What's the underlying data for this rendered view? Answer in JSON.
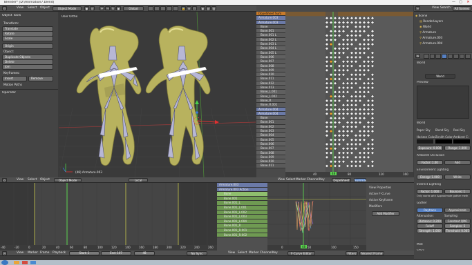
{
  "window": {
    "title": "Blender* [D:\\Animation7.blend]",
    "controls": [
      "—",
      "▢",
      "✕"
    ]
  },
  "header3d": {
    "menus": [
      "View",
      "Select",
      "Object"
    ],
    "mode": "Object Mode",
    "orientation": "Global"
  },
  "topRight": {
    "menus": [
      "View",
      "Search",
      "All Scenes"
    ]
  },
  "toolshelf": {
    "title": "Object Tools",
    "transform": {
      "title": "Transform:",
      "buttons": [
        "Translate",
        "Rotate",
        "Scale"
      ]
    },
    "origin_button": "Origin",
    "object": {
      "title": "Object:",
      "buttons": [
        "Duplicate Objects",
        "Delete",
        "Join"
      ]
    },
    "keyframes": {
      "title": "Keyframes:",
      "insert": "Insert",
      "remove": "Remove"
    },
    "motion_paths": "Motion Paths",
    "operator": "Operator"
  },
  "view3d": {
    "label": "User Ortho",
    "object_label": "(48) Armature.003"
  },
  "dopesheet": {
    "summary": "DopeSheet Sum",
    "rows": [
      "Armature.003",
      "Armature.003",
      "Bone",
      "Bone.001",
      "Bone.001 L",
      "Bone.002 L",
      "Bone.003 L",
      "Bone.004 L",
      "Bone.005 L",
      "Bone.006",
      "Bone.007",
      "Bone.008",
      "Bone.009",
      "Bone.010",
      "Bone.011",
      "Bone.012",
      "Bone.013",
      "Bone_L.001",
      "Bone_L.002",
      "Bone_R",
      "Bone_R.001",
      "Armature.004",
      "Armature.004",
      "Bone",
      "Bone.001",
      "Bone.002",
      "Bone.003",
      "Bone.004",
      "Bone.005",
      "Bone.006",
      "Bone.007",
      "Bone.008",
      "Bone.009",
      "Bone.010",
      "Bone.011"
    ],
    "header_menus": [
      "View",
      "Select",
      "Marker",
      "Channel",
      "Key"
    ],
    "mode": "DopeSheet",
    "summary_button": "Summary",
    "frame_numbers": [
      "40",
      "80",
      "120",
      "160"
    ],
    "current_frame": "48"
  },
  "outliner": {
    "items": [
      "Scene",
      "RenderLayers",
      "World",
      "Armature",
      "Armature.003",
      "Armature.004"
    ]
  },
  "properties": {
    "world_name": "World",
    "sections": [
      {
        "title": "World",
        "expanded": true
      },
      {
        "title": "Preview",
        "expanded": true
      },
      {
        "title": "World",
        "expanded": true
      },
      {
        "title": "Ambient Occlusion",
        "expanded": true
      },
      {
        "title": "Environment Lighting",
        "expanded": true
      },
      {
        "title": "Indirect Lighting",
        "expanded": true
      },
      {
        "title": "Gather",
        "expanded": true
      },
      {
        "title": "Mist",
        "expanded": false
      },
      {
        "title": "Stars",
        "expanded": false
      }
    ],
    "checks": [
      "Paper Sky",
      "Blend Sky",
      "Real Sky"
    ],
    "horizon_color": "Horizon Color:",
    "zenith_color": "Zenith Color:",
    "ambient_color": "Ambient C:",
    "exposure": "Exposure: 0.000",
    "range": "Range: 1.000",
    "ao_factor": "Factor: 1.00",
    "ao_mode": "Add",
    "env_energy": "Energy: 1.000",
    "env_color": "White",
    "indirect_factor": "Factor: 1.000",
    "bounces": "Bounces: 1",
    "indirect_note": "Only works with Approximate gather meth",
    "gather_modes": [
      "Raytrace",
      "Approximate"
    ],
    "attenuation": "Attenuation:",
    "sampling": "Sampling:",
    "distance": "Distance: 0.200",
    "constant": "Constant QMC",
    "falloff": "Falloff",
    "samples": "Samples: 5",
    "strength": "Strength: 1.000",
    "threshold": "Threshold: 0.005"
  },
  "timeline": {
    "header_menus": [
      "View",
      "Select",
      "Marker",
      "Frame",
      "Playback"
    ],
    "mode": "Object Mode",
    "orientation": "Local",
    "start": "Start: 1",
    "end": "End: 107",
    "frame": "48",
    "sync": "No Sync",
    "frame_numbers": [
      "-40",
      "-20",
      "0",
      "20",
      "40",
      "60",
      "80",
      "100",
      "120",
      "140",
      "160",
      "180",
      "200",
      "220",
      "240",
      "260"
    ],
    "bottom_menus": [
      "View",
      "Marker",
      "Frame",
      "Playback"
    ]
  },
  "channels": {
    "rows": [
      "Armature.003",
      "Armature.003 Action",
      "Bone",
      "Bone.001",
      "Bone.001_L",
      "Bone.001_L.001",
      "Bone.001_L.002",
      "Bone.001_L.003",
      "Bone.001_L.004",
      "Bone.001_R",
      "Bone.001_R.001",
      "Bone.001_R.002"
    ],
    "footer": [
      "View",
      "Select",
      "Marker",
      "Channel",
      "Key"
    ],
    "editor": "F-Curve Editor"
  },
  "graph": {
    "header_menus": [
      "View",
      "Select",
      "Marker",
      "Channel",
      "Key"
    ],
    "mode": "DopeSheet",
    "summary": "Summary",
    "frame_numbers": [
      "0",
      "50",
      "100",
      "150"
    ],
    "current_frame": "48",
    "footer_filters": "Filters",
    "nearest_frame": "Nearest Frame"
  },
  "fcurve": {
    "sections": [
      "View Properties",
      "Active F-Curve",
      "Active Keyframe",
      "Modifiers"
    ],
    "add_modifier": "Add Modifier"
  },
  "colors": {
    "accent": "#f0a030",
    "keyframe": "#f0f0f0",
    "frame_line": "#5bd44f",
    "mesh": "#c8c064"
  }
}
